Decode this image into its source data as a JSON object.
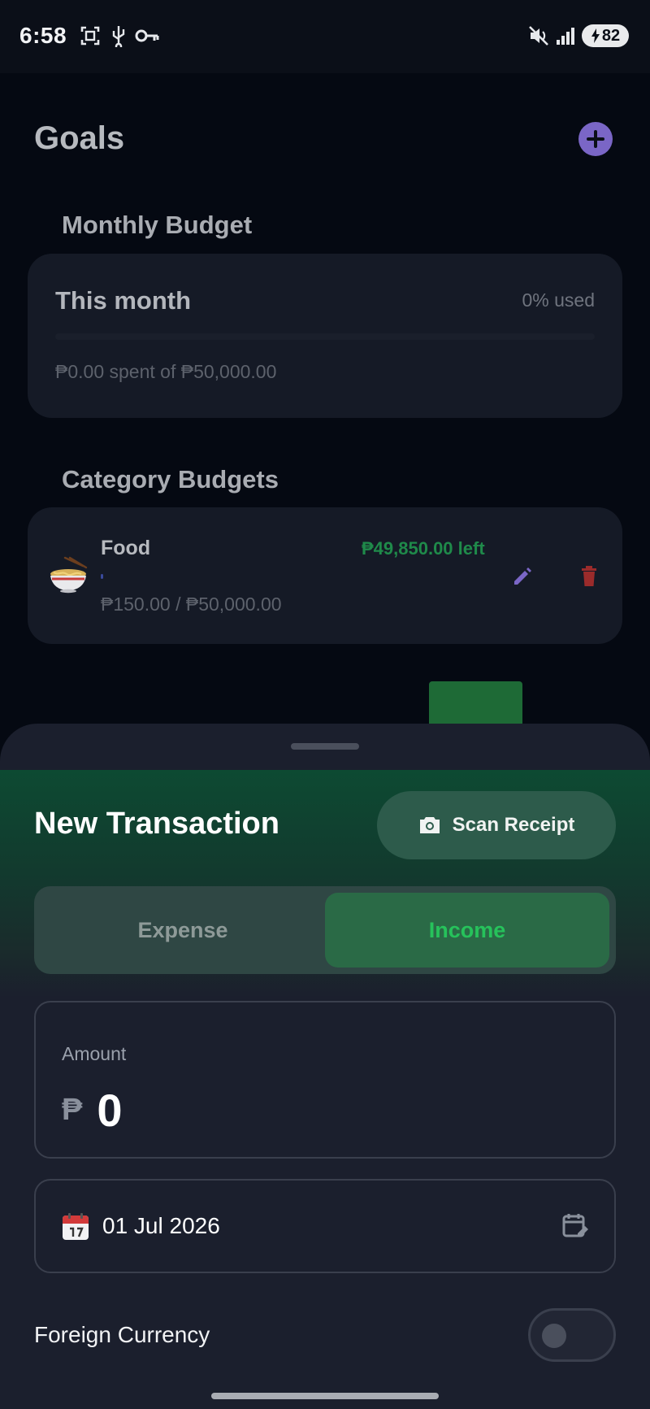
{
  "status_bar": {
    "time": "6:58",
    "battery": "82",
    "icons": [
      "screenshot-icon",
      "usb-icon",
      "key-icon",
      "mute-icon",
      "signal-icon",
      "battery-icon"
    ]
  },
  "goals": {
    "title": "Goals",
    "add_icon": "plus-icon",
    "monthly_heading": "Monthly Budget",
    "monthly_card": {
      "title": "This month",
      "used": "0% used",
      "spent_text": "₱0.00 spent of ₱50,000.00"
    },
    "category_heading": "Category Budgets",
    "categories": [
      {
        "icon": "noodle-bowl-icon",
        "name": "Food",
        "left": "₱49,850.00 left",
        "amount": "₱150.00 / ₱50,000.00",
        "progress": 0.003
      }
    ]
  },
  "sheet": {
    "title": "New Transaction",
    "scan_label": "Scan Receipt",
    "tabs": [
      {
        "label": "Expense",
        "selected": false
      },
      {
        "label": "Income",
        "selected": true
      }
    ],
    "amount": {
      "label": "Amount",
      "currency": "₱",
      "value": "0"
    },
    "date": "01 Jul 2026",
    "foreign_currency_label": "Foreign Currency",
    "foreign_currency_enabled": false
  },
  "colors": {
    "accent_purple": "#7a66c6",
    "income_green": "#26c25b",
    "delete_red": "#9b2b2b"
  }
}
